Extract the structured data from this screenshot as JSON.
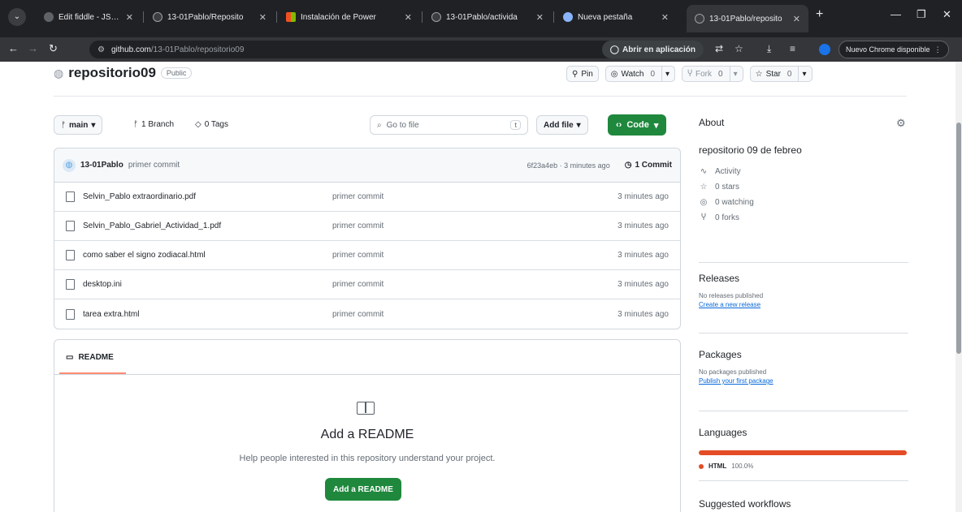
{
  "browser": {
    "tabs": [
      {
        "title": "Edit fiddle - JSFiddle",
        "icon": "jsfiddle-icon"
      },
      {
        "title": "13-01Pablo/Reposito",
        "icon": "github-icon"
      },
      {
        "title": "Instalación de Power",
        "icon": "microsoft-icon"
      },
      {
        "title": "13-01Pablo/activida",
        "icon": "github-icon"
      },
      {
        "title": "Nueva pestaña",
        "icon": "chrome-icon"
      },
      {
        "title": "13-01Pablo/reposito",
        "icon": "github-icon"
      }
    ],
    "url_host": "github.com",
    "url_path": "/13-01Pablo/repositorio09",
    "open_in_app": "Abrir en aplicación",
    "update_label": "Nuevo Chrome disponible"
  },
  "repo": {
    "name": "repositorio09",
    "visibility": "Public",
    "pin": "Pin",
    "watch": "Watch",
    "watch_count": "0",
    "fork": "Fork",
    "fork_count": "0",
    "star": "Star",
    "star_count": "0"
  },
  "filenav": {
    "branch": "main",
    "branches": "1 Branch",
    "tags": "0 Tags",
    "goto_placeholder": "Go to file",
    "goto_key": "t",
    "add_file": "Add file",
    "code": "Code"
  },
  "commit": {
    "author": "13-01Pablo",
    "message": "primer commit",
    "meta": "6f23a4eb · 3 minutes ago",
    "commits": "1 Commit"
  },
  "files": [
    {
      "name": "Selvin_Pablo extraordinario.pdf",
      "message": "primer commit",
      "time": "3 minutes ago"
    },
    {
      "name": "Selvin_Pablo_Gabriel_Actividad_1.pdf",
      "message": "primer commit",
      "time": "3 minutes ago"
    },
    {
      "name": "como saber el signo zodiacal.html",
      "message": "primer commit",
      "time": "3 minutes ago"
    },
    {
      "name": "desktop.ini",
      "message": "primer commit",
      "time": "3 minutes ago"
    },
    {
      "name": "tarea extra.html",
      "message": "primer commit",
      "time": "3 minutes ago"
    }
  ],
  "readme": {
    "tab": "README",
    "title": "Add a README",
    "text": "Help people interested in this repository understand your project.",
    "button": "Add a README"
  },
  "sidebar": {
    "about": "About",
    "description": "repositorio 09 de febreo",
    "activity": "Activity",
    "stars": "0 stars",
    "watching": "0 watching",
    "forks": "0 forks",
    "releases": "Releases",
    "releases_none": "No releases published",
    "releases_link": "Create a new release",
    "packages": "Packages",
    "packages_none": "No packages published",
    "packages_link": "Publish your first package",
    "languages": "Languages",
    "language_name": "HTML",
    "language_pct": "100.0%",
    "language_color": "#e34c26",
    "workflows": "Suggested workflows"
  }
}
